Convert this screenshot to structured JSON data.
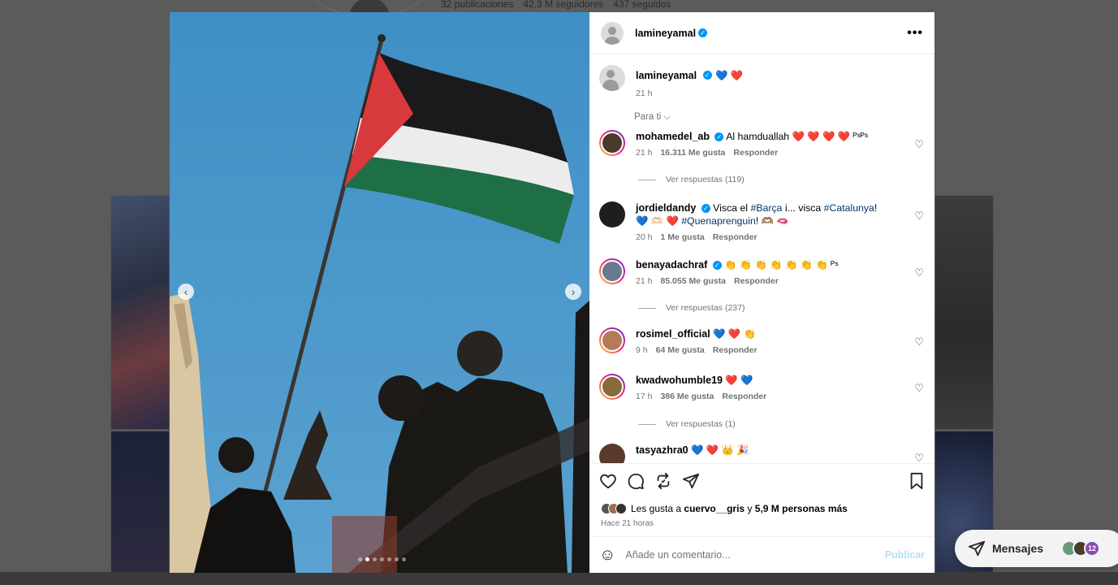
{
  "background_profile": {
    "stats": [
      "32 publicaciones",
      "42,3 M seguidores",
      "437 seguidos"
    ]
  },
  "post": {
    "owner": "lamineyamal",
    "more_label": "•••",
    "media": {
      "prev_label": "‹",
      "next_label": "›",
      "slide_count": 7,
      "active_slide": 2
    },
    "caption": {
      "username": "lamineyamal",
      "text": "💙 ❤️",
      "time": "21 h"
    },
    "sort_label": "Para ti ⌵",
    "comments": [
      {
        "username": "mohamedel_ab",
        "verified": true,
        "text": "Al hamduallah ❤️ ❤️ ❤️ ❤️ ᴾˢᴾˢ",
        "time": "21 h",
        "likes": "16.311 Me gusta",
        "reply": "Responder",
        "replies": "Ver respuestas (119)",
        "avatar_color": "#4a3a2c",
        "ring": true
      },
      {
        "username": "jordieldandy",
        "verified": true,
        "text_parts": [
          "Visca el ",
          "#Barça",
          " i... visca ",
          "#Catalunya",
          "!",
          "💙 🫶🏻 ❤️ ",
          "#Quenaprenguin",
          "! 🫶🏽 🫦"
        ],
        "time": "20 h",
        "likes": "1 Me gusta",
        "reply": "Responder",
        "avatar_color": "#1e1e1e",
        "ring": false
      },
      {
        "username": "benayadachraf",
        "verified": true,
        "text": "👏 👏 👏 👏 👏 👏 👏 ᴾˢ",
        "time": "21 h",
        "likes": "85.055 Me gusta",
        "reply": "Responder",
        "replies": "Ver respuestas (237)",
        "avatar_color": "#6a7a8c",
        "ring": true
      },
      {
        "username": "rosimel_official",
        "verified": false,
        "text": "💙 ❤️ 👏",
        "time": "9 h",
        "likes": "64 Me gusta",
        "reply": "Responder",
        "avatar_color": "#b57a5a",
        "ring": true
      },
      {
        "username": "kwadwohumble19",
        "verified": false,
        "text": "❤️ 💙",
        "time": "17 h",
        "likes": "386 Me gusta",
        "reply": "Responder",
        "replies": "Ver respuestas (1)",
        "avatar_color": "#8a6a3a",
        "ring": true
      },
      {
        "username": "tasyazhra0",
        "verified": false,
        "text": "💙 ❤️ 👑 🎉",
        "avatar_color": "#5a3a2a",
        "ring": false
      }
    ],
    "likes_summary": {
      "prefix": "Les gusta a ",
      "user": "cuervo__gris",
      "middle": " y ",
      "count": "5,9 M personas más"
    },
    "time_ago": "Hace 21 horas",
    "comment_placeholder": "Añade un comentario...",
    "publish_label": "Publicar"
  },
  "messages": {
    "label": "Mensajes",
    "badge": "12"
  },
  "colors": {
    "verified": "#0095f6",
    "hashtag": "#00376b",
    "publish_disabled": "#b2dffc",
    "muted": "#737373"
  }
}
